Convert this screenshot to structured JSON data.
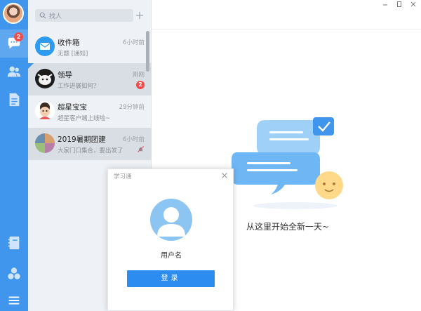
{
  "rail": {
    "messages_badge": "2",
    "icons": [
      "avatar",
      "chat-bubble-icon",
      "contacts-icon",
      "document-icon",
      "notebook-icon",
      "apps-icon",
      "menu-icon"
    ]
  },
  "list": {
    "search_placeholder": "找人",
    "conversations": [
      {
        "name": "收件箱",
        "preview": "无题 [通知]",
        "time": "6小时前",
        "unread": ""
      },
      {
        "name": "领导",
        "preview": "工作进展如何？",
        "time": "刚刚",
        "unread": "2"
      },
      {
        "name": "超星宝宝",
        "preview": "超星客户端上线啦~",
        "time": "29分钟前",
        "unread": ""
      },
      {
        "name": "2019暑期团建",
        "preview": "大家门口集合，要出发了",
        "time": "6小时前",
        "unread": ""
      }
    ]
  },
  "main": {
    "welcome_text": "从这里开始全新一天~"
  },
  "dialog": {
    "title": "学习通",
    "username": "用户名",
    "login_label": "登录"
  },
  "colors": {
    "accent": "#3f96ec",
    "button": "#2d8cf0",
    "badge": "#f24b4b"
  }
}
